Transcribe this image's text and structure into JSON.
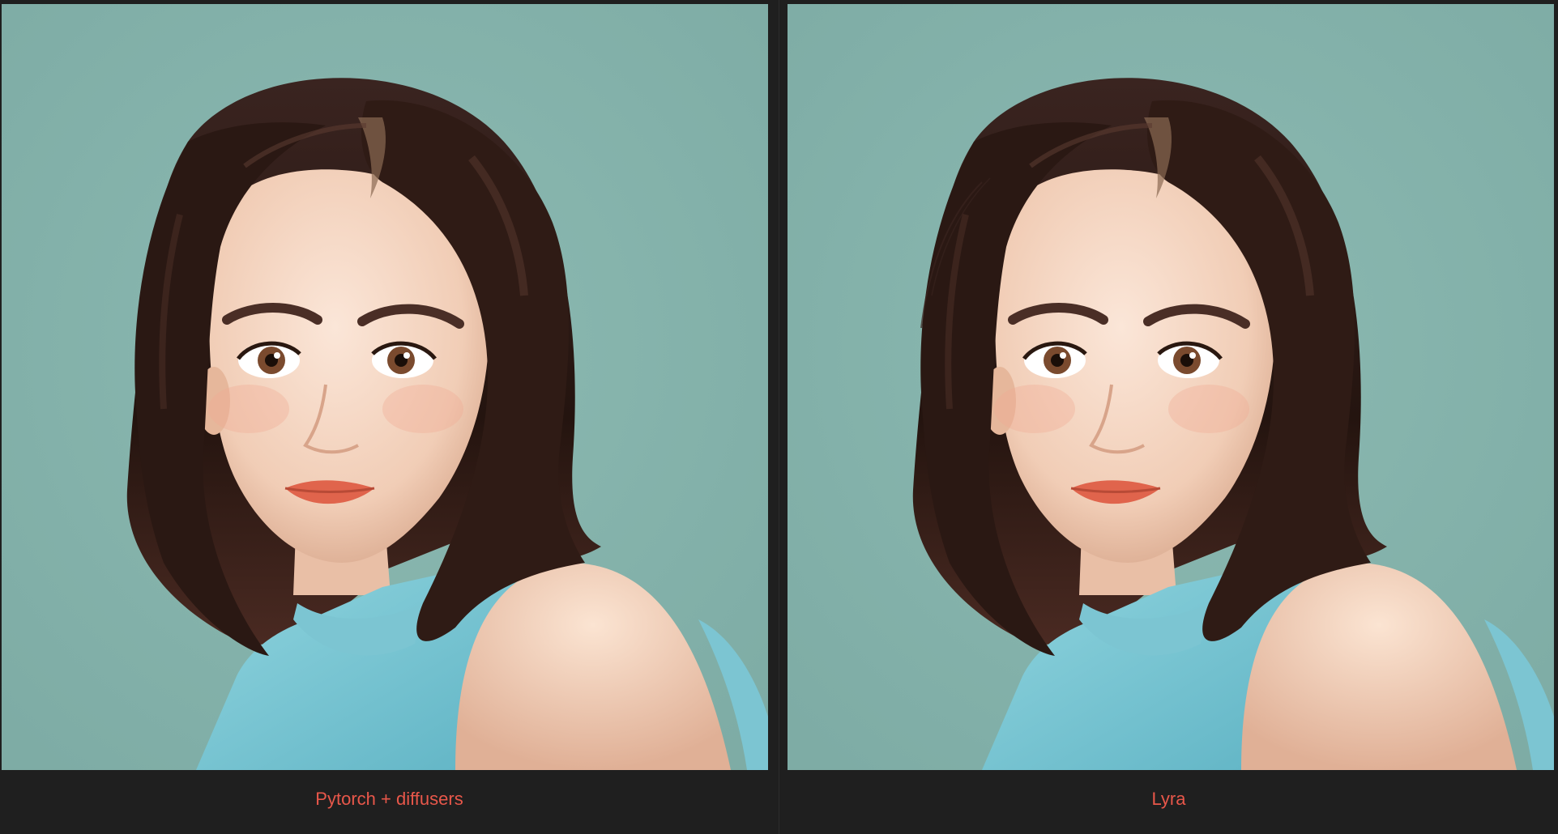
{
  "colors": {
    "caption_text": "#e8574a",
    "page_background": "#1f1f1f",
    "image_background": "#84b2ab"
  },
  "panels": [
    {
      "caption": "Pytorch + diffusers"
    },
    {
      "caption": "Lyra"
    }
  ]
}
